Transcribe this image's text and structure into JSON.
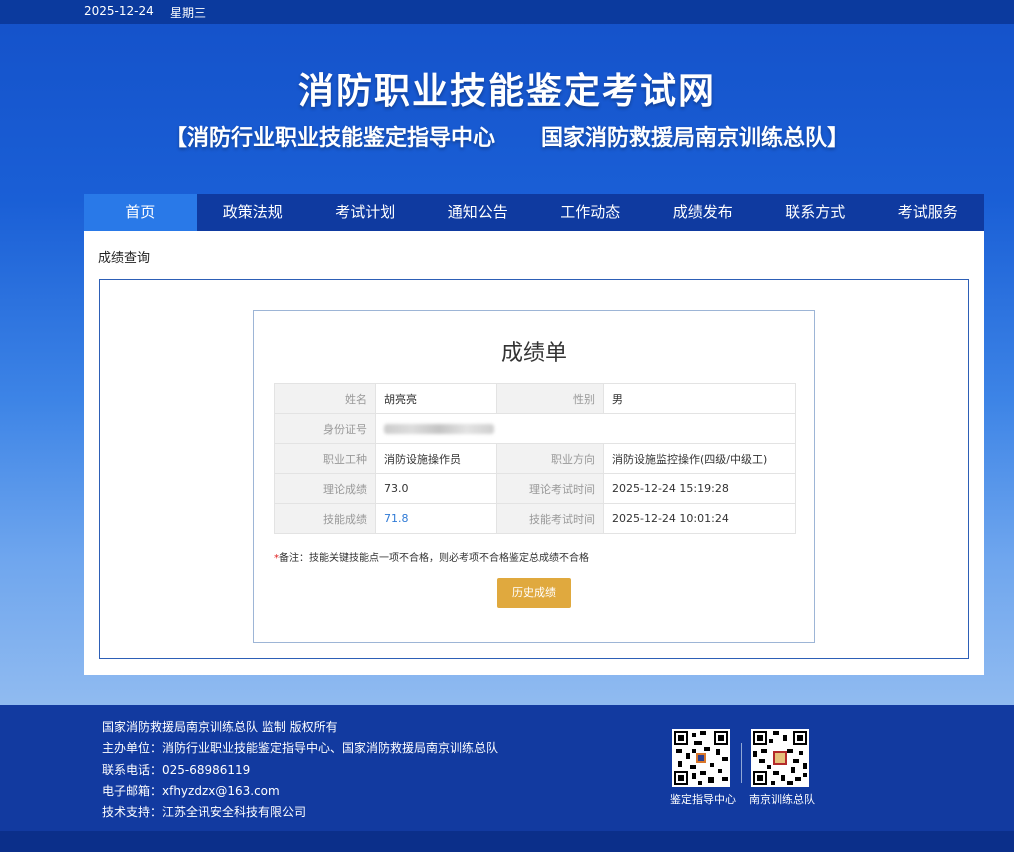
{
  "topbar": {
    "date": "2025-12-24",
    "weekday": "星期三"
  },
  "header": {
    "title": "消防职业技能鉴定考试网",
    "subtitle": "【消防行业职业技能鉴定指导中心      国家消防救援局南京训练总队】"
  },
  "nav": {
    "items": [
      "首页",
      "政策法规",
      "考试计划",
      "通知公告",
      "工作动态",
      "成绩发布",
      "联系方式",
      "考试服务"
    ],
    "active_index": 0
  },
  "breadcrumb": "成绩查询",
  "report": {
    "title": "成绩单",
    "rows": {
      "name_label": "姓名",
      "name_value": "胡亮亮",
      "gender_label": "性别",
      "gender_value": "男",
      "id_label": "身份证号",
      "id_value": "",
      "occupation_label": "职业工种",
      "occupation_value": "消防设施操作员",
      "direction_label": "职业方向",
      "direction_value": "消防设施监控操作(四级/中级工)",
      "theory_score_label": "理论成绩",
      "theory_score_value": "73.0",
      "theory_time_label": "理论考试时间",
      "theory_time_value": "2025-12-24 15:19:28",
      "skill_score_label": "技能成绩",
      "skill_score_value": "71.8",
      "skill_time_label": "技能考试时间",
      "skill_time_value": "2025-12-24 10:01:24"
    },
    "note_star": "*",
    "note": "备注：技能关键技能点一项不合格，则必考项不合格鉴定总成绩不合格",
    "history_button": "历史成绩"
  },
  "footer": {
    "copyright": "国家消防救援局南京训练总队 监制 版权所有",
    "organizer": "主办单位：消防行业职业技能鉴定指导中心、国家消防救援局南京训练总队",
    "phone": "联系电话：025-68986119",
    "email": "电子邮箱：xfhyzdzx@163.com",
    "support": "技术支持：江苏全讯安全科技有限公司",
    "qr1_caption": "鉴定指导中心",
    "qr2_caption": "南京训练总队"
  },
  "colors": {
    "nav_bg": "#0f3aa0",
    "nav_active": "#2979e8",
    "button": "#e0a93e",
    "footer_bg": "#123aa0"
  }
}
